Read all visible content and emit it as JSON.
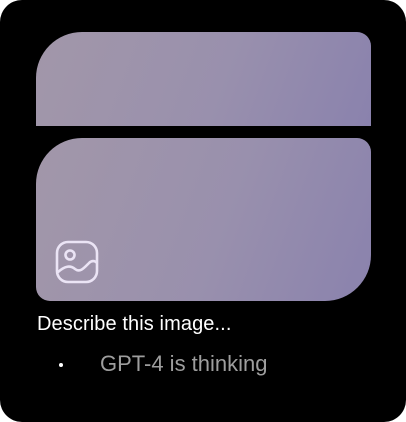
{
  "prompt": {
    "text": "Describe this image..."
  },
  "status": {
    "text": "GPT-4 is thinking"
  },
  "icons": {
    "image_placeholder": "image-icon"
  },
  "colors": {
    "background": "#000000",
    "panel_gradient_start": "#a297a9",
    "panel_gradient_end": "#8a82ad",
    "icon_stroke": "#ebe4f5",
    "caption_text": "#ffffff",
    "status_text": "#9e9e9e"
  }
}
